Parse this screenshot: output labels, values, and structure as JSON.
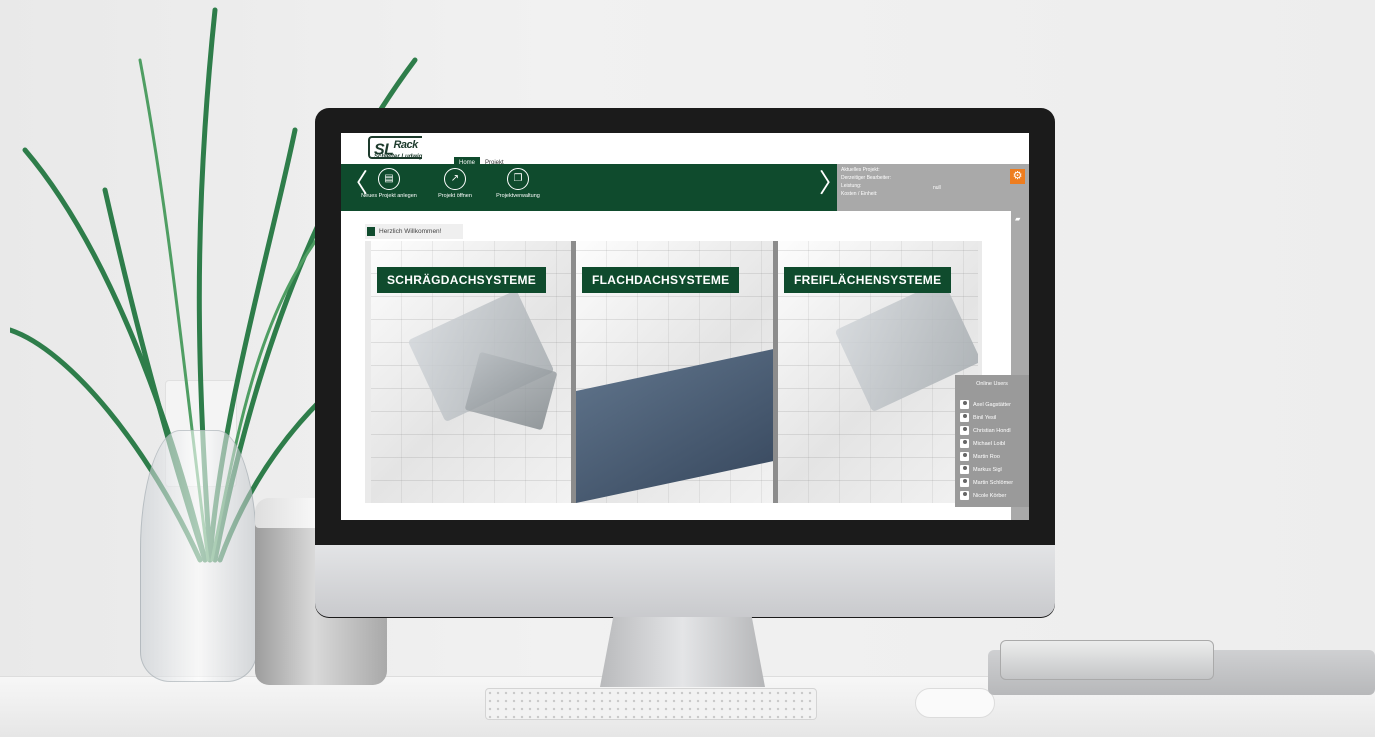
{
  "app": {
    "logo": {
      "main": "SL",
      "sup": "Rack",
      "sub": "Schletter Ludwig"
    },
    "tabs": [
      {
        "label": "Home",
        "active": true
      },
      {
        "label": "Projekt",
        "active": false
      }
    ],
    "ribbon": {
      "buttons": [
        {
          "label": "Neues Projekt anlegen",
          "icon": "new-project-icon"
        },
        {
          "label": "Projekt öffnen",
          "icon": "open-project-icon"
        },
        {
          "label": "Projektverwaltung",
          "icon": "project-management-icon"
        }
      ],
      "prev_arrow": "〈",
      "next_arrow": "〉"
    },
    "info": {
      "lines": [
        "Aktuelles Projekt:",
        "Derzeitiger Bearbeiter:",
        "Leistung:",
        "Kosten / Einheit:"
      ],
      "leistung_value": "null"
    },
    "welcome": "Herzlich Willkommen!",
    "panels": [
      {
        "label": "SCHRÄGDACHSYSTEME"
      },
      {
        "label": "FLACHDACHSYSTEME"
      },
      {
        "label": "FREIFLÄCHENSYSTEME"
      }
    ],
    "online_users": {
      "title": "Online Users",
      "users": [
        "Axel Gagstätter",
        "Binil Yesil",
        "Christian Hondl",
        "Michael Loibl",
        "Martin Roo",
        "Markus Sigl",
        "Martin Schlömer",
        "Nicole Körber"
      ]
    },
    "colors": {
      "primary": "#0f4b2d",
      "accent": "#ee7d1f",
      "panel_gray": "#a9a9a9"
    }
  }
}
